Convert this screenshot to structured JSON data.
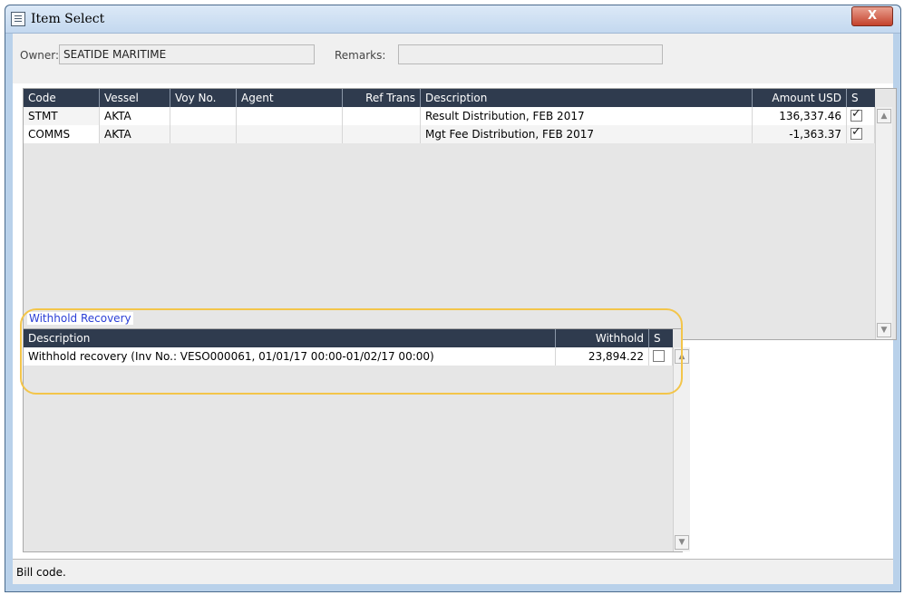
{
  "window": {
    "title": "Item Select",
    "close_label": "X"
  },
  "header": {
    "owner_label": "Owner:",
    "owner_value": "SEATIDE MARITIME",
    "remarks_label": "Remarks:",
    "remarks_value": ""
  },
  "items_table": {
    "columns": [
      "Code",
      "Vessel",
      "Voy No.",
      "Agent",
      "Ref Trans",
      "Description",
      "Amount USD",
      "S"
    ],
    "rows": [
      {
        "code": "STMT",
        "vessel": "AKTA",
        "voy_no": "",
        "agent": "",
        "ref_trans": "",
        "description": "Result Distribution, FEB 2017",
        "amount": "136,337.46",
        "selected": true
      },
      {
        "code": "COMMS",
        "vessel": "AKTA",
        "voy_no": "",
        "agent": "",
        "ref_trans": "",
        "description": "Mgt Fee Distribution, FEB 2017",
        "amount": "-1,363.37",
        "selected": true
      }
    ]
  },
  "withhold": {
    "section_label": "Withhold Recovery",
    "columns": [
      "Description",
      "Withhold",
      "S"
    ],
    "rows": [
      {
        "description": "Withhold recovery (Inv No.: VESO000061, 01/01/17 00:00-01/02/17 00:00)",
        "withhold": "23,894.22",
        "selected": false
      }
    ]
  },
  "status_bar": {
    "text": "Bill code."
  },
  "icons": {
    "window": "list-icon",
    "scroll_up": "scroll-up-arrow-icon",
    "scroll_down": "scroll-down-arrow-icon",
    "checkmark": "checkmark-icon"
  },
  "colors": {
    "header_bg": "#2f3b4e",
    "section_label": "#2b3fd6",
    "highlight": "#f3c54a",
    "close_button": "#c4422c"
  }
}
